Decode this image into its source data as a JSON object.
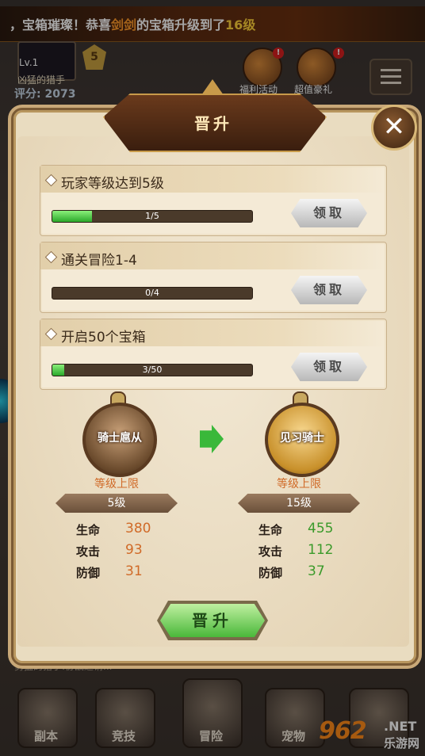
{
  "banner": {
    "prefix": "，宝箱璀璨！恭喜",
    "player": "剑剑",
    "middle": "的宝箱升级到了",
    "level": "16级"
  },
  "player": {
    "level": "Lv.1",
    "name": "凶猛的猎手",
    "score": "评分: 2073",
    "vip": "5"
  },
  "top_icons": [
    {
      "label": "福利活动",
      "badge": "!"
    },
    {
      "label": "超值豪礼",
      "badge": "!"
    }
  ],
  "chat_preview": "勇猛的猎手:协战邀请...",
  "bottom_nav": [
    "副本",
    "竞技",
    "冒险",
    "宠物",
    ""
  ],
  "watermark": {
    "num": "962",
    "net": ".NET",
    "sub": "乐游网"
  },
  "dialog": {
    "title": "晋升",
    "tasks": [
      {
        "title": "玩家等级达到5级",
        "progress_text": "1/5",
        "progress": 0.2,
        "claim_label": "领取"
      },
      {
        "title": "通关冒险1-4",
        "progress_text": "0/4",
        "progress": 0.0,
        "claim_label": "领取"
      },
      {
        "title": "开启50个宝箱",
        "progress_text": "3/50",
        "progress": 0.06,
        "claim_label": "领取"
      }
    ],
    "current": {
      "rank": "骑士扈从",
      "cap_label": "等级上限",
      "cap_value": "5级",
      "stats": [
        {
          "name": "生命",
          "value": "380"
        },
        {
          "name": "攻击",
          "value": "93"
        },
        {
          "name": "防御",
          "value": "31"
        }
      ]
    },
    "next": {
      "rank": "见习骑士",
      "cap_label": "等级上限",
      "cap_value": "15级",
      "stats": [
        {
          "name": "生命",
          "value": "455"
        },
        {
          "name": "攻击",
          "value": "112"
        },
        {
          "name": "防御",
          "value": "37"
        }
      ]
    },
    "promote_label": "晋升"
  },
  "colors": {
    "accent_orange": "#d06a28",
    "accent_green": "#3a9a2a",
    "progress_green": "#2aa82a"
  }
}
